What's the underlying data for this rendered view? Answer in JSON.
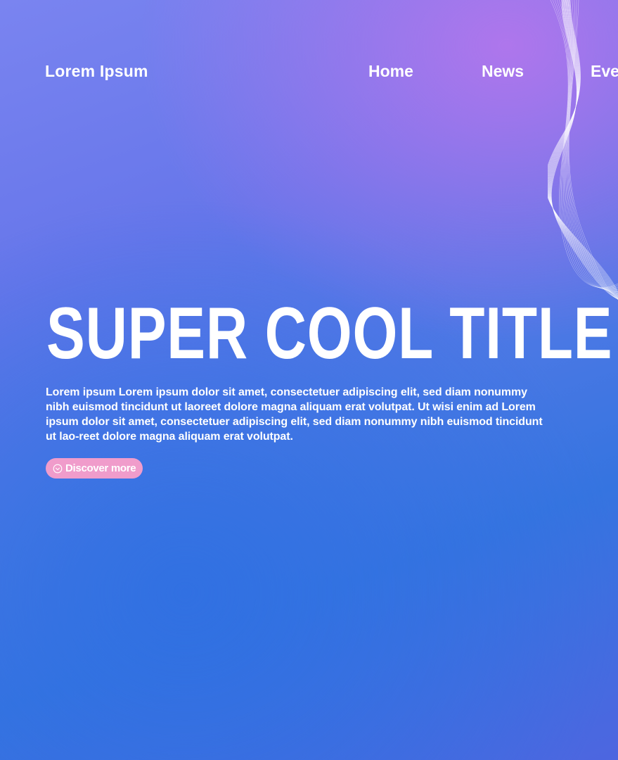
{
  "header": {
    "brand": "Lorem Ipsum",
    "nav": [
      "Home",
      "News",
      "Events"
    ]
  },
  "hero": {
    "title": "SUPER COOL TITLE",
    "body": "Lorem ipsum Lorem ipsum dolor sit amet, consectetuer adipiscing elit, sed diam nonummy nibh euismod tincidunt ut laoreet dolore magna aliquam erat volutpat. Ut wisi enim ad Lorem ipsum dolor sit amet, consectetuer adipiscing elit, sed diam nonummy nibh euismod tincidunt ut lao-reet dolore magna aliquam erat volutpat.",
    "cta_label": "Discover more",
    "cta_icon": "chevron-down-circle-icon"
  },
  "colors": {
    "accent_button": "#f09ccb",
    "text": "#ffffff",
    "gradient_top": "#7a84f0",
    "gradient_mid": "#3574e0",
    "gradient_corner": "#b276ec"
  }
}
